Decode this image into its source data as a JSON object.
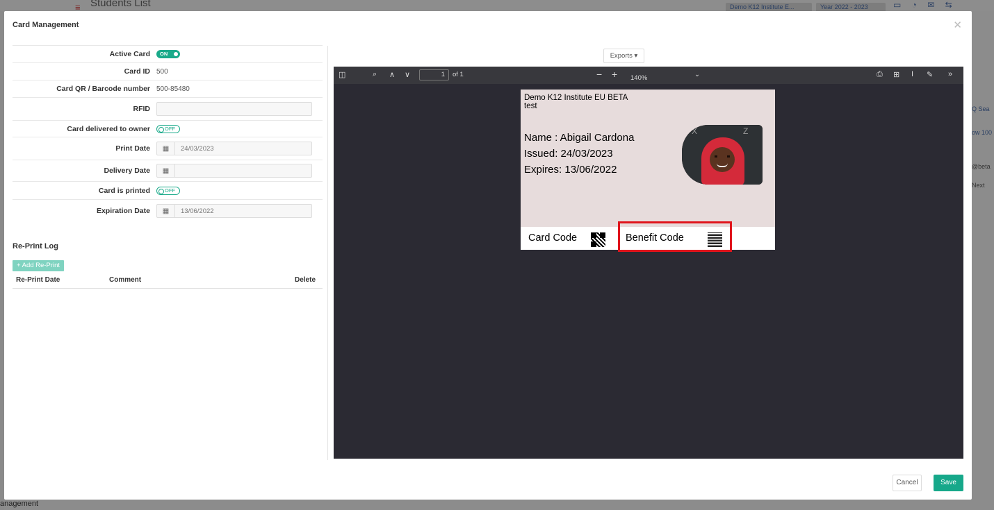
{
  "background": {
    "title": "Students List",
    "institute_chip": "Demo K12 Institute E...",
    "year_chip": "Year 2022 - 2023",
    "badge_a": "24",
    "badge_b": "0",
    "sidebar_bottom": "anagement",
    "right_search": "Q Sea",
    "right_show": "ow 100",
    "right_email": "@beta",
    "right_next": "Next"
  },
  "modal": {
    "title": "Card Management",
    "close_icon": "close-icon"
  },
  "form": {
    "active_card_label": "Active Card",
    "active_card_toggle": "ON",
    "card_id_label": "Card ID",
    "card_id_value": "500",
    "qr_label": "Card QR / Barcode number",
    "qr_value": "500-85480",
    "rfid_label": "RFID",
    "rfid_value": "",
    "delivered_label": "Card delivered to owner",
    "delivered_toggle": "OFF",
    "print_date_label": "Print Date",
    "print_date_value": "24/03/2023",
    "delivery_date_label": "Delivery Date",
    "delivery_date_value": "",
    "printed_label": "Card is printed",
    "printed_toggle": "OFF",
    "expiration_label": "Expiration Date",
    "expiration_value": "13/06/2022"
  },
  "reprint": {
    "title": "Re-Print Log",
    "add_button": "+ Add Re-Print",
    "columns": [
      "Re-Print Date",
      "Comment",
      "Delete"
    ]
  },
  "viewer": {
    "exports_label": "Exports ▾",
    "page_number": "1",
    "page_total": "of 1",
    "zoom": "140%"
  },
  "card": {
    "institute": "Demo K12 Institute EU BETA",
    "subtitle": "test",
    "name": "Name : Abigail Cardona",
    "issued": "Issued: 24/03/2023",
    "expires": "Expires: 13/06/2022",
    "card_code_label": "Card Code",
    "benefit_code_label": "Benefit Code",
    "highlight_color": "#e0141c"
  },
  "footer": {
    "cancel": "Cancel",
    "save": "Save"
  }
}
